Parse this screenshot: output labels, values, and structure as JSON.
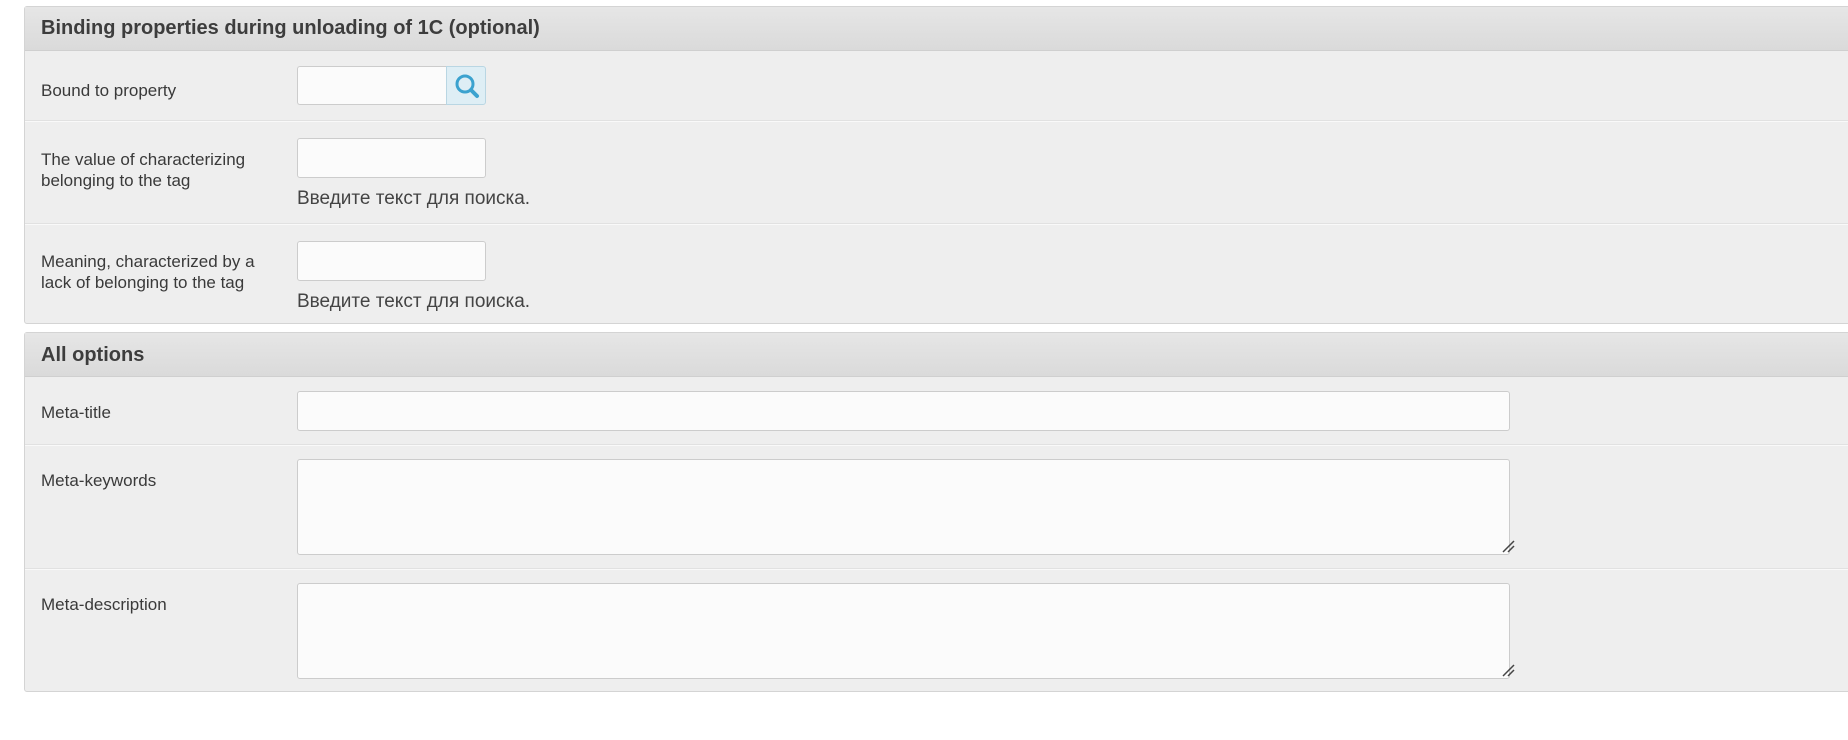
{
  "binding_section": {
    "title": "Binding properties during unloading of 1C (optional)",
    "bound_property": {
      "label": "Bound to property",
      "value": ""
    },
    "tag_belonging_value": {
      "label": "The value of characterizing belonging to the tag",
      "value": "",
      "hint": "Введите текст для поиска."
    },
    "tag_absence_value": {
      "label": "Meaning, characterized by a lack of belonging to the tag",
      "value": "",
      "hint": "Введите текст для поиска."
    }
  },
  "options_section": {
    "title": "All options",
    "meta_title": {
      "label": "Meta-title",
      "value": ""
    },
    "meta_keywords": {
      "label": "Meta-keywords",
      "value": ""
    },
    "meta_description": {
      "label": "Meta-description",
      "value": ""
    }
  },
  "icons": {
    "search": "search-icon",
    "resize": "resize-grip-icon"
  },
  "colors": {
    "panel_bg": "#eeeeee",
    "header_bg": "#dadada",
    "search_accent": "#3ba2cf"
  }
}
